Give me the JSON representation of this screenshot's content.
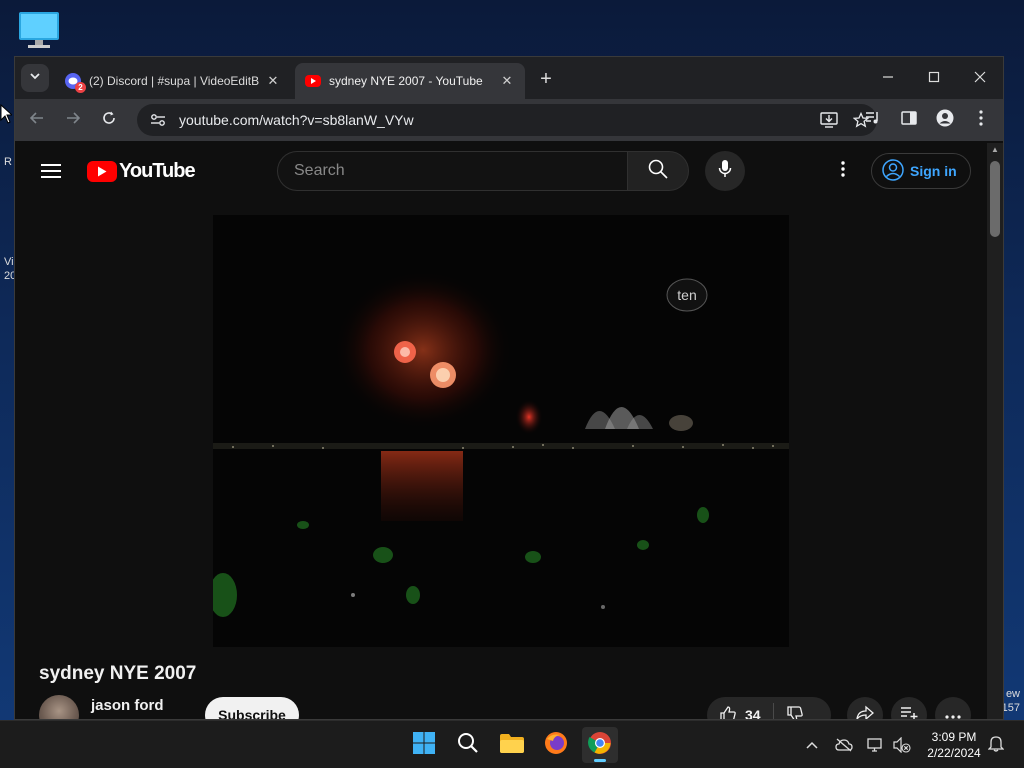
{
  "desktop": {
    "side_text_1": "R",
    "side_text_2": "Vi",
    "side_text_3": "20",
    "right_text_1": "ew",
    "right_text_2": "157"
  },
  "browser": {
    "tabs": [
      {
        "title": "(2) Discord | #supa | VideoEditB",
        "badge": "2",
        "active": false
      },
      {
        "title": "sydney NYE 2007 - YouTube",
        "active": true
      }
    ],
    "url": "youtube.com/watch?v=sb8lanW_VYw"
  },
  "youtube": {
    "logo_text": "YouTube",
    "search_placeholder": "Search",
    "signin_label": "Sign in",
    "video": {
      "watermark": "ten",
      "title": "sydney NYE 2007"
    },
    "channel": {
      "name": "jason ford",
      "subscribe_label": "Subscribe"
    },
    "like_count": "34"
  },
  "taskbar": {
    "time": "3:09 PM",
    "date": "2/22/2024"
  },
  "colors": {
    "youtube_red": "#ff0000",
    "link_blue": "#3ea6ff",
    "taskbar_accent": "#60cdff"
  }
}
